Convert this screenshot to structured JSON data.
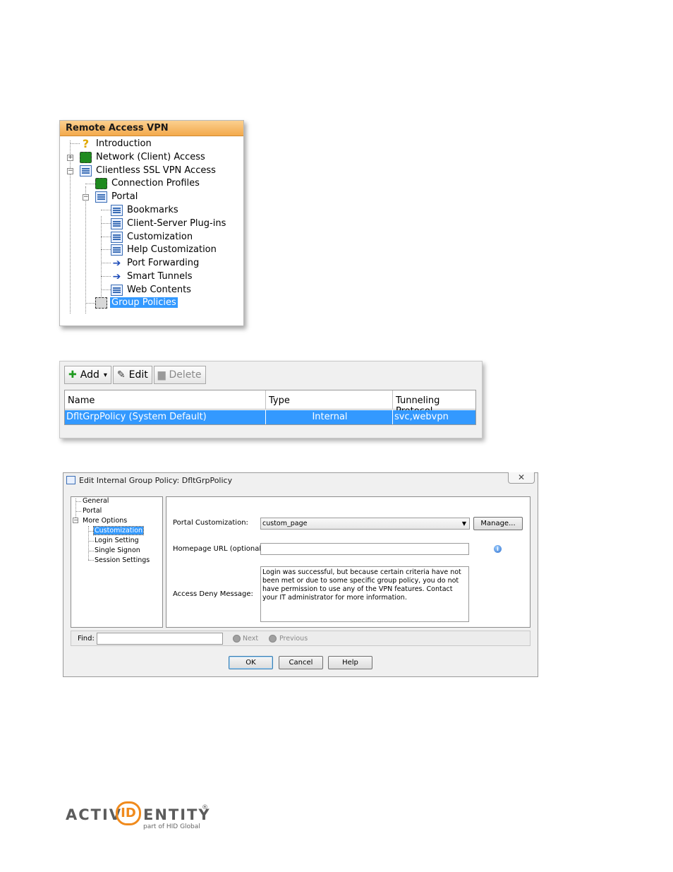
{
  "vpn_tree": {
    "header": "Remote Access VPN",
    "items": [
      {
        "label": "Introduction"
      },
      {
        "label": "Network (Client) Access"
      },
      {
        "label": "Clientless SSL VPN Access"
      },
      {
        "label": "Connection Profiles"
      },
      {
        "label": "Portal"
      },
      {
        "label": "Bookmarks"
      },
      {
        "label": "Client-Server Plug-ins"
      },
      {
        "label": "Customization"
      },
      {
        "label": "Help Customization"
      },
      {
        "label": "Port Forwarding"
      },
      {
        "label": "Smart Tunnels"
      },
      {
        "label": "Web Contents"
      },
      {
        "label": "Group Policies"
      }
    ],
    "expand_plus": "+",
    "expand_minus": "−"
  },
  "policy_list": {
    "toolbar": {
      "add": "Add",
      "edit": "Edit",
      "delete": "Delete",
      "add_dropdown": "▾"
    },
    "columns": [
      "Name",
      "Type",
      "Tunneling Protocol"
    ],
    "rows": [
      {
        "name": "DfltGrpPolicy (System Default)",
        "type": "Internal",
        "protocol": "svc,webvpn"
      }
    ]
  },
  "dialog": {
    "title": "Edit Internal Group Policy: DfltGrpPolicy",
    "close": "✕",
    "nav": [
      "General",
      "Portal",
      "More Options",
      "Customization",
      "Login Setting",
      "Single Signon",
      "Session Settings"
    ],
    "portal_customization_label": "Portal Customization:",
    "portal_customization_value": "custom_page",
    "manage_label": "Manage...",
    "homepage_label": "Homepage URL (optional):",
    "homepage_value": "",
    "access_deny_label": "Access Deny Message:",
    "access_deny_value": "Login was successful, but because certain criteria have not been met or due to some specific group policy, you do not have permission to use any of the VPN features. Contact your IT administrator for more information.",
    "find_label": "Find:",
    "next_label": "Next",
    "previous_label": "Previous",
    "ok_label": "OK",
    "cancel_label": "Cancel",
    "help_label": "Help"
  },
  "logo": {
    "word_left": "ACTIV",
    "mark": "ID",
    "word_right": "ENTITY",
    "registered": "®",
    "tagline": "part of HID Global"
  },
  "colors": {
    "selection": "#3399ff",
    "header_orange": "#f3a94c",
    "logo_orange": "#f08a1c"
  }
}
